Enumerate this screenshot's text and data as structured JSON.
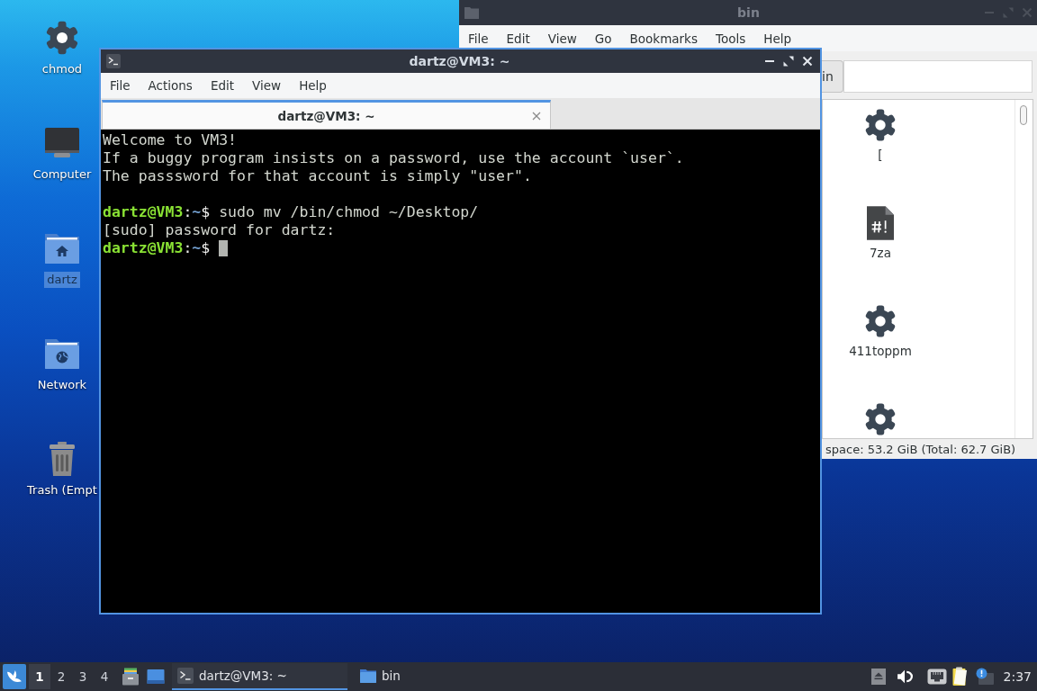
{
  "desktop_icons": [
    {
      "label": "chmod",
      "kind": "gear",
      "selected": false
    },
    {
      "label": "Computer",
      "kind": "computer",
      "selected": false
    },
    {
      "label": "dartz",
      "kind": "home",
      "selected": true
    },
    {
      "label": "Network",
      "kind": "network",
      "selected": false
    },
    {
      "label": "Trash (Empt",
      "kind": "trash",
      "selected": false
    }
  ],
  "file_manager": {
    "title": "bin",
    "active": false,
    "menu": [
      "File",
      "Edit",
      "View",
      "Go",
      "Bookmarks",
      "Tools",
      "Help"
    ],
    "path_button": "in",
    "items": [
      {
        "label": "[",
        "kind": "gear"
      },
      {
        "label": "7za",
        "kind": "script"
      },
      {
        "label": "411toppm",
        "kind": "gear"
      },
      {
        "kind": "gear"
      }
    ],
    "status": "space: 53.2 GiB (Total: 62.7 GiB)"
  },
  "terminal": {
    "title": "dartz@VM3: ~",
    "active": true,
    "menu": [
      "File",
      "Actions",
      "Edit",
      "View",
      "Help"
    ],
    "tabs": [
      {
        "label": "dartz@VM3: ~",
        "selected": true
      }
    ],
    "lines": [
      {
        "kind": "output",
        "text": "Welcome to VM3!"
      },
      {
        "kind": "output",
        "text": "If a buggy program insists on a password, use the account `user`."
      },
      {
        "kind": "output",
        "text": "The passsword for that account is simply \"user\"."
      },
      {
        "kind": "blank"
      },
      {
        "kind": "prompt",
        "user_host": "dartz@VM3",
        "separator": ":",
        "path": "~",
        "symbol": "$",
        "command": "sudo mv /bin/chmod ~/Desktop/",
        "cursor": false
      },
      {
        "kind": "output",
        "text": "[sudo] password for dartz:"
      },
      {
        "kind": "prompt",
        "user_host": "dartz@VM3",
        "separator": ":",
        "path": "~",
        "symbol": "$",
        "cursor": true
      }
    ]
  },
  "taskbar": {
    "workspaces": [
      {
        "label": "1",
        "selected": true
      },
      {
        "label": "2",
        "selected": false
      },
      {
        "label": "3",
        "selected": false
      },
      {
        "label": "4",
        "selected": false
      }
    ],
    "tasks": [
      {
        "label": "dartz@VM3: ~",
        "kind": "terminal",
        "selected": true
      },
      {
        "label": "bin",
        "kind": "folder",
        "selected": false
      }
    ],
    "clock": "2:37"
  }
}
